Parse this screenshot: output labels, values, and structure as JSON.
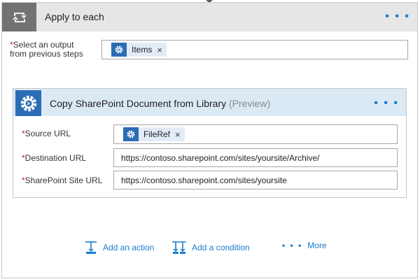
{
  "apply_to_each": {
    "title": "Apply to each",
    "more_label": "• • •",
    "output_field": {
      "required_mark": "*",
      "label_line1": "Select an output",
      "label_line2": "from previous steps",
      "token_label": "Items",
      "token_remove": "×"
    }
  },
  "copy_action": {
    "title": "Copy SharePoint Document from Library",
    "preview_tag": "(Preview)",
    "more_label": "• • •",
    "fields": {
      "source_url": {
        "required_mark": "*",
        "label": "Source URL",
        "token_label": "FileRef",
        "token_remove": "×"
      },
      "destination_url": {
        "required_mark": "*",
        "label": "Destination URL",
        "value": "https://contoso.sharepoint.com/sites/yoursite/Archive/"
      },
      "site_url": {
        "required_mark": "*",
        "label": "SharePoint Site URL",
        "value": "https://contoso.sharepoint.com/sites/yoursite"
      }
    }
  },
  "footer": {
    "add_action": "Add an action",
    "add_condition": "Add a condition",
    "more_dots": "• • •",
    "more_label": "More"
  },
  "icons": {
    "loop": "loop-icon",
    "gear": "gear-icon",
    "add_action": "add-action-icon",
    "add_condition": "add-condition-icon"
  },
  "colors": {
    "accent": "#1b7bd0",
    "action_blue": "#2b6cb5",
    "header_gray": "#e6e6e6",
    "loop_icon_bg": "#727272",
    "action_header_bg": "#dbe9f5",
    "required": "#d21f1f"
  }
}
